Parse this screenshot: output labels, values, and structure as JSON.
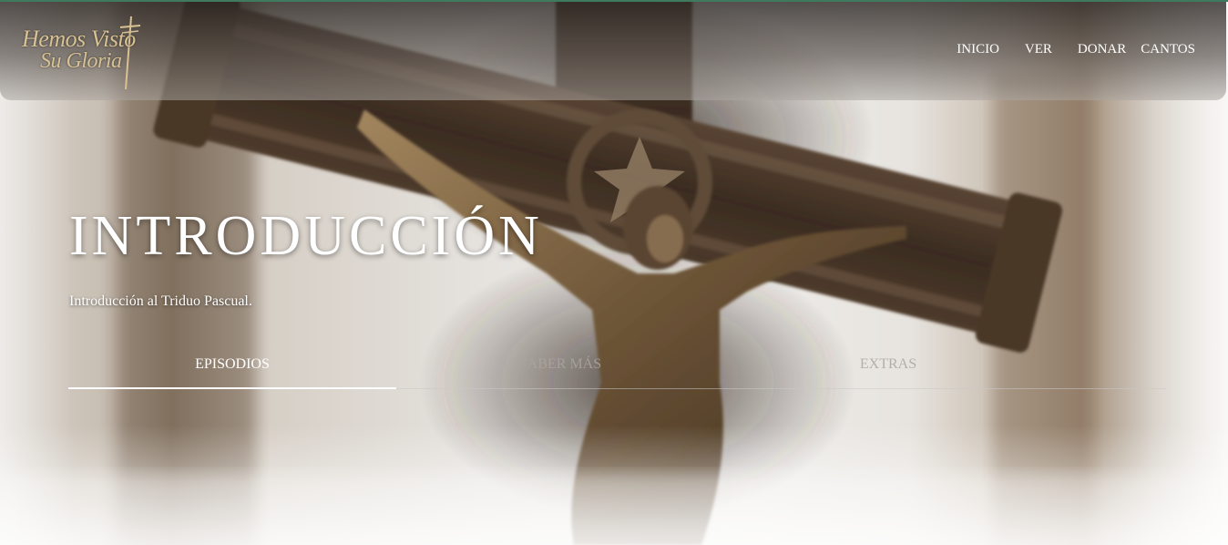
{
  "header": {
    "logo": {
      "line1": "Hemos Visto",
      "line2": "Su Gloria",
      "icon": "cross-icon"
    },
    "nav": [
      {
        "label": "INICIO"
      },
      {
        "label": "VER"
      },
      {
        "label": "DONAR"
      },
      {
        "label": "CANTOS"
      }
    ]
  },
  "hero": {
    "title": "INTRODUCCIÓN",
    "subtitle": "Introducción al Triduo Pascual.",
    "background_image": "crucifix-photo",
    "tabs": [
      {
        "label": "EPISODIOS",
        "active": true
      },
      {
        "label": "SABER MÁS",
        "active": false
      },
      {
        "label": "EXTRAS",
        "active": false
      }
    ]
  },
  "colors": {
    "accent_top_bar": "#3f7a5f",
    "logo_gold": "#d8c294",
    "text": "#ffffff"
  }
}
